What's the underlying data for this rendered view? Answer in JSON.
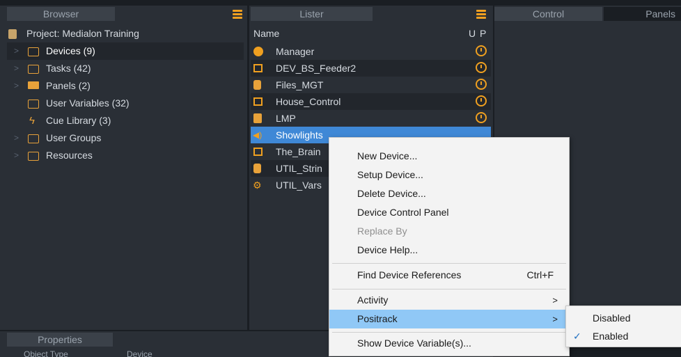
{
  "browser": {
    "title": "Browser",
    "project": "Project: Medialon Training",
    "items": [
      {
        "label": "Devices (9)",
        "icon": "folder-gear-icon"
      },
      {
        "label": "Tasks (42)",
        "icon": "tasks-icon"
      },
      {
        "label": "Panels (2)",
        "icon": "monitor-icon"
      },
      {
        "label": "User Variables (32)",
        "icon": "variables-icon"
      },
      {
        "label": "Cue Library (3)",
        "icon": "lightning-icon"
      },
      {
        "label": "User Groups",
        "icon": "folder-icon"
      },
      {
        "label": "Resources",
        "icon": "folder-icon"
      }
    ]
  },
  "lister": {
    "title": "Lister",
    "col_name": "Name",
    "col_u": "U",
    "col_p": "P",
    "rows": [
      {
        "name": "Manager",
        "icon": "play-icon"
      },
      {
        "name": "DEV_BS_Feeder2",
        "icon": "device-icon"
      },
      {
        "name": "Files_MGT",
        "icon": "files-icon"
      },
      {
        "name": "House_Control",
        "icon": "device-icon"
      },
      {
        "name": "LMP",
        "icon": "lmp-icon"
      },
      {
        "name": "Showlights",
        "icon": "light-icon"
      },
      {
        "name": "The_Brain",
        "icon": "device-icon"
      },
      {
        "name": "UTIL_Strin",
        "icon": "files-icon"
      },
      {
        "name": "UTIL_Vars",
        "icon": "gear-icon"
      }
    ]
  },
  "control": {
    "title": "Control"
  },
  "panels": {
    "title": "Panels"
  },
  "properties": {
    "title": "Properties",
    "col1": "Object Type",
    "col2": "Device"
  },
  "context_menu": {
    "items": [
      {
        "label": "New Device..."
      },
      {
        "label": "Setup Device..."
      },
      {
        "label": "Delete Device..."
      },
      {
        "label": "Device Control Panel"
      },
      {
        "label": "Replace By",
        "disabled": true
      },
      {
        "label": "Device Help..."
      },
      {
        "label": "Find Device References",
        "shortcut": "Ctrl+F"
      },
      {
        "label": "Activity",
        "submenu": true
      },
      {
        "label": "Positrack",
        "submenu": true,
        "highlighted": true
      },
      {
        "label": "Show Device Variable(s)..."
      }
    ],
    "arrow_glyph": ">"
  },
  "submenu": {
    "items": [
      {
        "label": "Disabled",
        "checked": false
      },
      {
        "label": "Enabled",
        "checked": true
      }
    ],
    "check_glyph": "✓"
  },
  "colors": {
    "accent": "#f0a020",
    "selection": "#3f88d6",
    "menu_highlight": "#90c8f6"
  }
}
